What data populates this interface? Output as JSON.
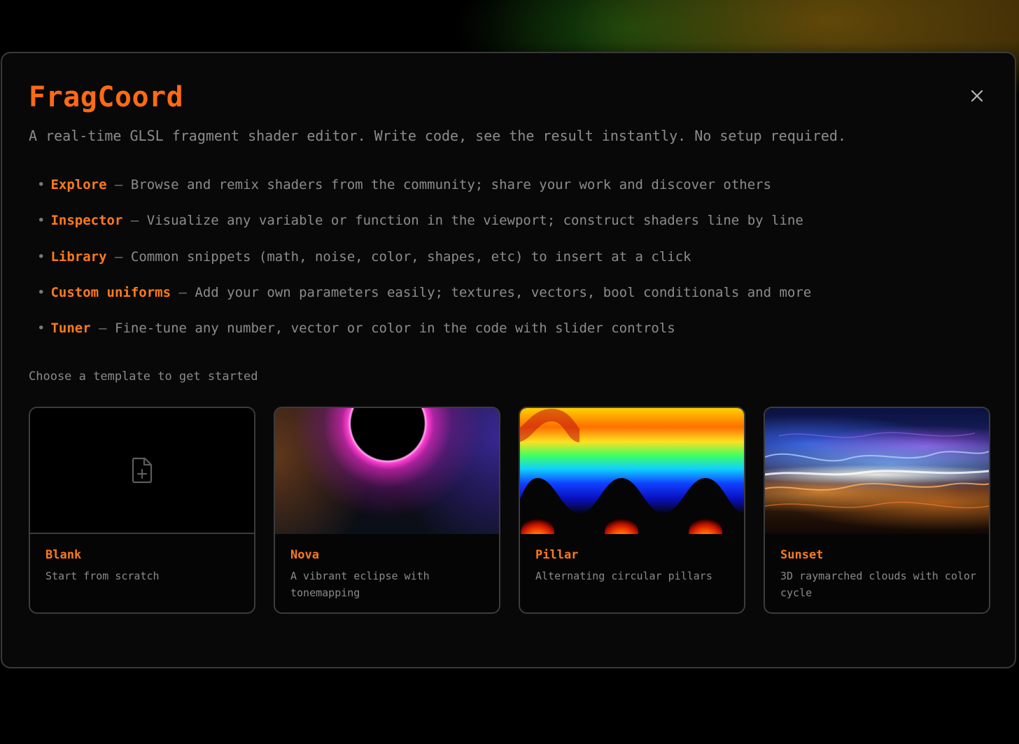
{
  "modal": {
    "title": "FragCoord",
    "close_icon": "close-icon",
    "subtitle": "A real-time GLSL fragment shader editor. Write code, see the result instantly. No setup required.",
    "features": [
      {
        "name": "Explore",
        "desc": "Browse and remix shaders from the community; share your work and discover others"
      },
      {
        "name": "Inspector",
        "desc": "Visualize any variable or function in the viewport; construct shaders line by line"
      },
      {
        "name": "Library",
        "desc": "Common snippets (math, noise, color, shapes, etc) to insert at a click"
      },
      {
        "name": "Custom uniforms",
        "desc": "Add your own parameters easily; textures, vectors, bool conditionals and more"
      },
      {
        "name": "Tuner",
        "desc": "Fine-tune any number, vector or color in the code with slider controls"
      }
    ],
    "bullet": "•",
    "dash": "—",
    "choose_label": "Choose a template to get started",
    "templates": [
      {
        "name": "Blank",
        "desc": "Start from scratch",
        "icon": "file-plus-icon"
      },
      {
        "name": "Nova",
        "desc": "A vibrant eclipse with tonemapping"
      },
      {
        "name": "Pillar",
        "desc": "Alternating circular pillars"
      },
      {
        "name": "Sunset",
        "desc": "3D raymarched clouds with color cycle"
      }
    ]
  },
  "colors": {
    "accent": "#ff7a1a",
    "text_muted": "#8c8c8c",
    "border": "#3c3c3c",
    "modal_bg": "#080808"
  }
}
